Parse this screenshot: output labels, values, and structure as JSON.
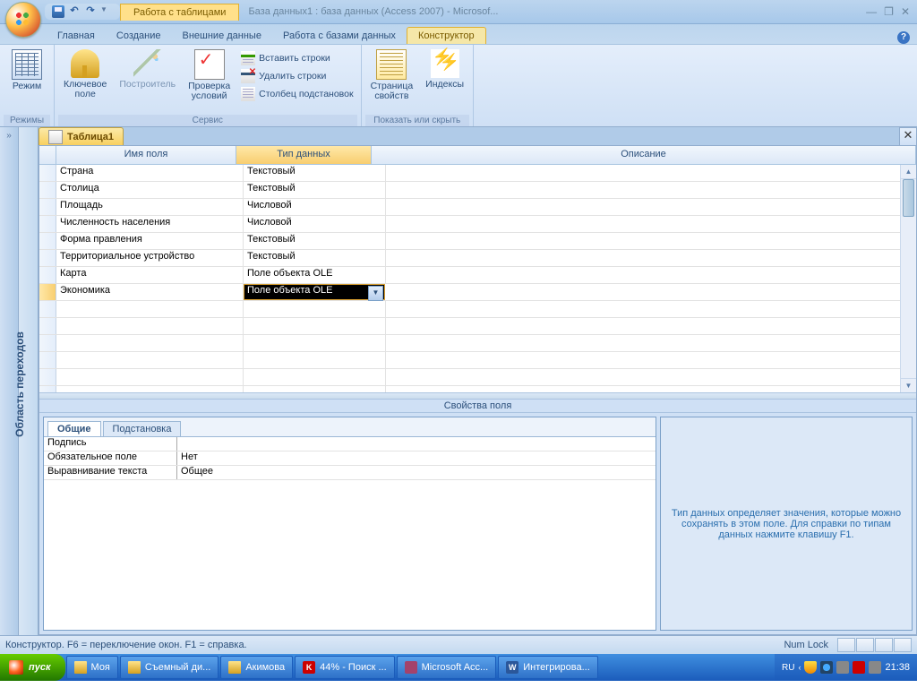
{
  "titlebar": {
    "context_tab": "Работа с таблицами",
    "doc_title": "База данных1 : база данных (Access 2007) - Microsof..."
  },
  "ribbon_tabs": [
    "Главная",
    "Создание",
    "Внешние данные",
    "Работа с базами данных",
    "Конструктор"
  ],
  "ribbon": {
    "groups": {
      "views": {
        "label": "Режимы",
        "btn_view": "Режим"
      },
      "tools": {
        "label": "Сервис",
        "btn_key": "Ключевое\nполе",
        "btn_builder": "Построитель",
        "btn_validate": "Проверка\nусловий",
        "btn_insert": "Вставить строки",
        "btn_delete": "Удалить строки",
        "btn_lookup": "Столбец подстановок"
      },
      "showhide": {
        "label": "Показать или скрыть",
        "btn_props": "Страница\nсвойств",
        "btn_index": "Индексы"
      }
    }
  },
  "nav_pane_label": "Область переходов",
  "document": {
    "tab": "Таблица1"
  },
  "design_grid": {
    "col_name": "Имя поля",
    "col_type": "Тип данных",
    "col_desc": "Описание",
    "rows": [
      {
        "name": "Страна",
        "type": "Текстовый"
      },
      {
        "name": "Столица",
        "type": "Текстовый"
      },
      {
        "name": "Площадь",
        "type": "Числовой"
      },
      {
        "name": "Численность населения",
        "type": "Числовой"
      },
      {
        "name": "Форма правления",
        "type": "Текстовый"
      },
      {
        "name": "Территориальное устройство",
        "type": "Текстовый"
      },
      {
        "name": "Карта",
        "type": "Поле объекта OLE"
      },
      {
        "name": "Экономика",
        "type": "Поле объекта OLE"
      }
    ],
    "selected_index": 7
  },
  "field_props": {
    "title": "Свойства поля",
    "tabs": {
      "general": "Общие",
      "lookup": "Подстановка"
    },
    "rows": [
      {
        "n": "Подпись",
        "v": ""
      },
      {
        "n": "Обязательное поле",
        "v": "Нет"
      },
      {
        "n": "Выравнивание текста",
        "v": "Общее"
      }
    ],
    "help": "Тип данных определяет значения, которые можно сохранять в этом поле.  Для справки по типам данных нажмите клавишу F1."
  },
  "statusbar": {
    "text": "Конструктор.  F6 = переключение окон.  F1 = справка.",
    "numlock": "Num Lock"
  },
  "taskbar": {
    "start": "пуск",
    "buttons": [
      {
        "icon": "folder",
        "label": "Моя"
      },
      {
        "icon": "folder",
        "label": "Съемный ди..."
      },
      {
        "icon": "folder",
        "label": "Акимова"
      },
      {
        "icon": "k",
        "label": "44% - Поиск ..."
      },
      {
        "icon": "acc",
        "label": "Microsoft Acc..."
      },
      {
        "icon": "word",
        "label": "Интегрирова..."
      }
    ],
    "lang": "RU",
    "clock": "21:38"
  }
}
